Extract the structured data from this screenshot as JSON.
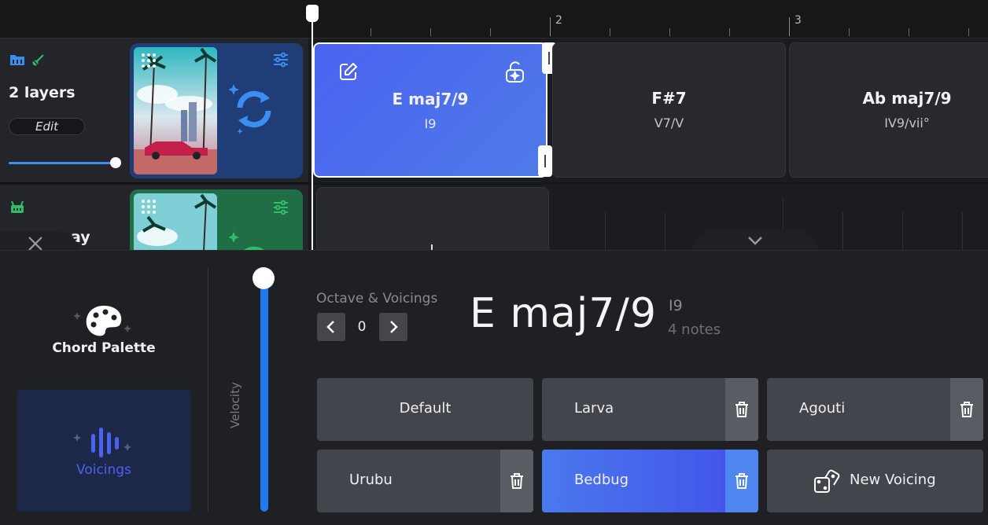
{
  "timeline": {
    "bar_numbers": [
      "2",
      "3"
    ]
  },
  "tracks": [
    {
      "title": "2 layers",
      "edit_label": "Edit",
      "volume": 0.98
    },
    {
      "title_partial": "ay"
    }
  ],
  "chords": [
    {
      "name": "E maj7/9",
      "function": "I9",
      "selected": true
    },
    {
      "name": "F#7",
      "function": "V7/V",
      "selected": false
    },
    {
      "name": "Ab maj7/9",
      "function": "IV9/vii°",
      "selected": false
    }
  ],
  "sidebar": {
    "chord_palette_label": "Chord Palette",
    "voicings_label": "Voicings"
  },
  "velocity": {
    "label": "Velocity",
    "value": 1.0
  },
  "octave": {
    "label": "Octave & Voicings",
    "value": "0"
  },
  "current_chord": {
    "name": "E maj7/9",
    "function": "I9",
    "notes": "4 notes"
  },
  "voicings": [
    {
      "label": "Default",
      "deletable": false,
      "selected": false
    },
    {
      "label": "Larva",
      "deletable": true,
      "selected": false
    },
    {
      "label": "Agouti",
      "deletable": true,
      "selected": false
    },
    {
      "label": "Urubu",
      "deletable": true,
      "selected": false
    },
    {
      "label": "Bedbug",
      "deletable": true,
      "selected": true
    },
    {
      "label": "New Voicing",
      "deletable": false,
      "selected": false
    }
  ],
  "colors": {
    "accent_blue": "#4a62f0",
    "track1_icon": "#3a8ef0",
    "track2_icon": "#2fbf6a"
  }
}
